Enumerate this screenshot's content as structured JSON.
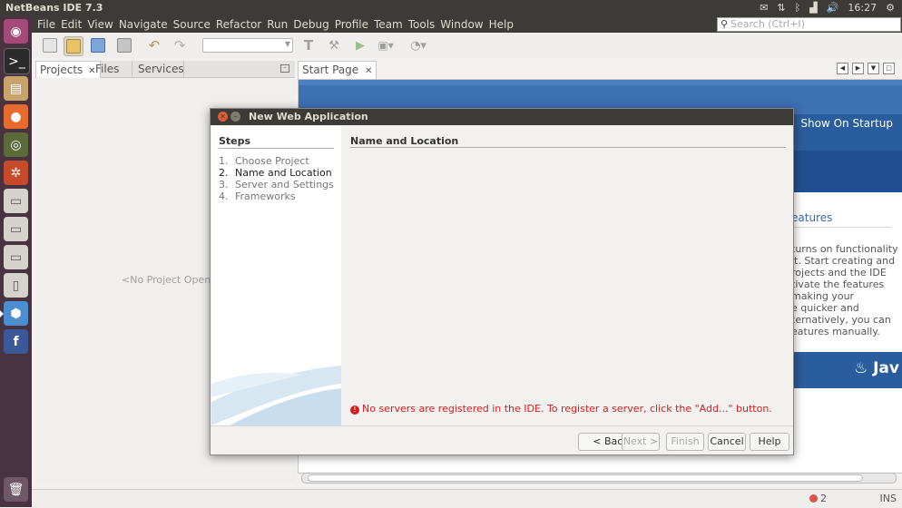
{
  "top_panel": {
    "app_title": "NetBeans IDE 7.3",
    "clock": "16:27"
  },
  "menubar": {
    "items": [
      "File",
      "Edit",
      "View",
      "Navigate",
      "Source",
      "Refactor",
      "Run",
      "Debug",
      "Profile",
      "Team",
      "Tools",
      "Window",
      "Help"
    ],
    "search_placeholder": "Search (Ctrl+I)"
  },
  "left_panel": {
    "tabs": [
      "Projects",
      "Files",
      "Services"
    ],
    "empty_text": "<No Project Open>"
  },
  "editor": {
    "tab": "Start Page",
    "show_on_startup": "Show On Startup",
    "features_heading": "eatures",
    "body_lines": [
      "turns on functionality",
      "it. Start creating and",
      "rojects and the IDE",
      "tivate the features",
      "making your",
      "e quicker and",
      "ternatively, you can",
      "eatures manually."
    ],
    "java_text": "Jav"
  },
  "dialog": {
    "title": "New Web Application",
    "steps_title": "Steps",
    "steps": [
      {
        "num": "1.",
        "label": "Choose Project"
      },
      {
        "num": "2.",
        "label": "Name and Location"
      },
      {
        "num": "3.",
        "label": "Server and Settings"
      },
      {
        "num": "4.",
        "label": "Frameworks"
      }
    ],
    "current_step": 2,
    "content_title": "Name and Location",
    "error_message": "No servers are registered in the IDE. To register a server, click the \"Add...\" button.",
    "buttons": {
      "back": "< Back",
      "next": "Next >",
      "finish": "Finish",
      "cancel": "Cancel",
      "help": "Help"
    }
  },
  "statusbar": {
    "error_count": "2",
    "mode": "INS"
  }
}
